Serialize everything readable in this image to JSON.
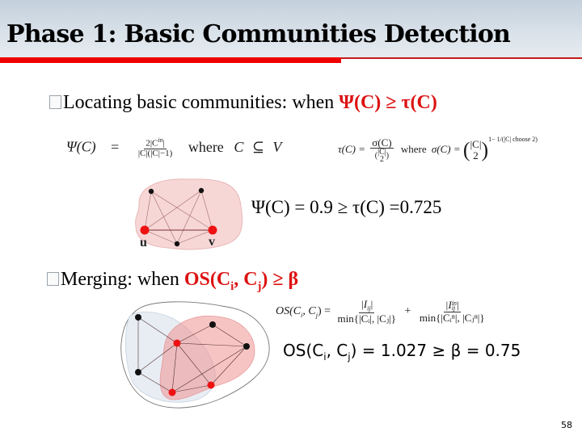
{
  "slide": {
    "title": "Phase 1: Basic Communities Detection",
    "page_number": "58",
    "accent_color": "#ee0000",
    "highlight_color": "#dd1111"
  },
  "bullet1": {
    "text": "Locating basic communities: when ",
    "condition": "Ψ(C) ≥ τ(C)"
  },
  "formula_psi": {
    "lhs": "Ψ(C)",
    "equals": "=",
    "numerator": "2|C",
    "numerator_sup": "in",
    "numerator_end": "|",
    "denominator": "|C|(|C|−1)",
    "where": "where",
    "subset_expr": "C ⊆ V"
  },
  "formula_tau": {
    "lhs": "τ(C) =",
    "numerator": "σ(C)",
    "denominator": "(|C| choose 2)",
    "where": "where",
    "sigma_expr": "σ(C) =",
    "binom_top": "|C|",
    "binom_bottom": "2",
    "exponent": "1− 1/(|C| choose 2)"
  },
  "graph1": {
    "node_labels": [
      "u",
      "v"
    ]
  },
  "result1": {
    "text": "Ψ(C) = 0.9 ≥ τ(C) =0.725"
  },
  "bullet2": {
    "text": "Merging: when ",
    "cond_prefix": "OS(C",
    "sub_i": "i",
    "cond_mid": ", C",
    "sub_j": "j",
    "cond_suffix": ") ≥ β"
  },
  "formula_os": {
    "lhs": "OS(C",
    "lhs_sub_i": "i",
    "lhs_mid": ", C",
    "lhs_sub_j": "j",
    "lhs_end": ") =",
    "term1_num": "|I",
    "term1_num_sub": "ij",
    "term1_num_end": "|",
    "term1_den": "min{|Cᵢ|, |Cⱼ|}",
    "plus": "+",
    "term2_num": "|I",
    "term2_num_sup": "in",
    "term2_num_sub": "ij",
    "term2_den": "min{|Cᵢⁿ|, |Cⱼⁿ|}"
  },
  "result2": {
    "prefix": "OS(C",
    "sub_i": "i",
    "mid": ", C",
    "sub_j": "j",
    "suffix": ") = 1.027 ≥ β = 0.75"
  }
}
